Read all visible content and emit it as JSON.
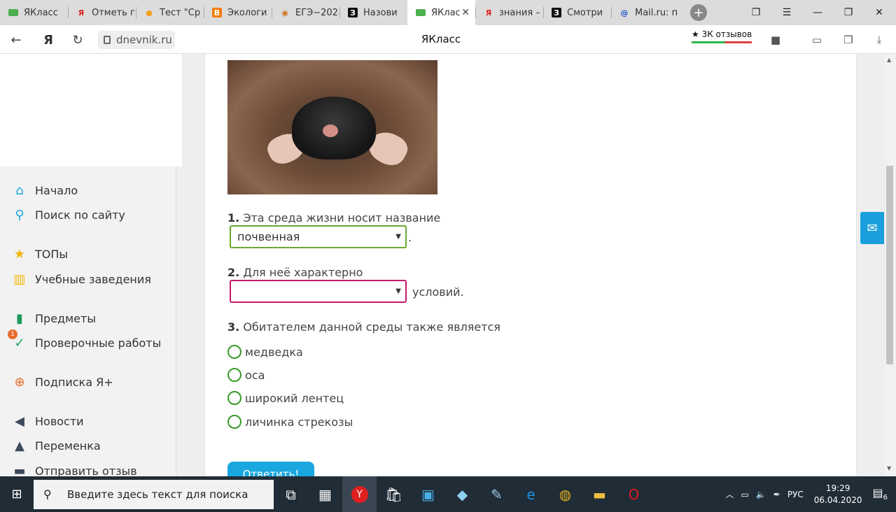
{
  "browser": {
    "tabs": [
      {
        "title": "ЯКласс",
        "icon": "yaklass-icon",
        "color": "#4caf50",
        "active": false
      },
      {
        "title": "Отметь г",
        "icon": "yandex-icon",
        "color": "#e02020",
        "active": false
      },
      {
        "title": "Тест \"Ср",
        "icon": "test-icon",
        "color": "#f0a020",
        "active": false
      },
      {
        "title": "Экологи",
        "icon": "blogger-icon",
        "color": "#f57c00",
        "active": false
      },
      {
        "title": "ЕГЭ−202",
        "icon": "ege-icon",
        "color": "#d0701c",
        "active": false
      },
      {
        "title": "Назови",
        "icon": "znanija-icon",
        "color": "#111111",
        "active": false
      },
      {
        "title": "ЯКлас",
        "icon": "yaklass-icon",
        "color": "#4caf50",
        "active": true
      },
      {
        "title": "знания –",
        "icon": "yandex-icon",
        "color": "#e02020",
        "active": false
      },
      {
        "title": "Смотри",
        "icon": "znanija-icon",
        "color": "#111111",
        "active": false
      },
      {
        "title": "Mail.ru: п",
        "icon": "mailru-icon",
        "color": "#1a4fc4",
        "active": false
      }
    ],
    "url": "dnevnik.ru",
    "page_title": "ЯКласс",
    "reviews": "★ 3К отзывов"
  },
  "sidebar": {
    "items": [
      {
        "label": "Начало",
        "icon": "home-icon",
        "glyph": "⌂",
        "color": "#1aa7e0"
      },
      {
        "label": "Поиск по сайту",
        "icon": "search-icon",
        "glyph": "⚲",
        "color": "#1aa7e0"
      },
      {
        "label": "ТОПы",
        "icon": "star-icon",
        "glyph": "★",
        "color": "#f5b400"
      },
      {
        "label": "Учебные заведения",
        "icon": "institution-icon",
        "glyph": "🏛",
        "color": "#f5b400"
      },
      {
        "label": "Предметы",
        "icon": "book-icon",
        "glyph": "▮",
        "color": "#1b9a5a"
      },
      {
        "label": "Проверочные работы",
        "icon": "check-icon",
        "glyph": "✓",
        "color": "#1b9a5a",
        "badge": "1"
      },
      {
        "label": "Подписка Я+",
        "icon": "subscription-icon",
        "glyph": "⊕",
        "color": "#e86c2d"
      },
      {
        "label": "Новости",
        "icon": "megaphone-icon",
        "glyph": "◀",
        "color": "#3c4a5a"
      },
      {
        "label": "Переменка",
        "icon": "bell-icon",
        "glyph": "🔔",
        "color": "#3c4a5a"
      },
      {
        "label": "Отправить отзыв",
        "icon": "feedback-icon",
        "glyph": "▬",
        "color": "#3c4a5a"
      }
    ]
  },
  "quiz": {
    "q1": {
      "num": "1.",
      "text": "Эта среда жизни носит название",
      "selected": "почвенная",
      "suffix": "."
    },
    "q2": {
      "num": "2.",
      "text": "Для неё характерно",
      "selected": "",
      "suffix": "условий."
    },
    "q3": {
      "num": "3.",
      "text": "Обитателем данной среды также является",
      "options": [
        "медведка",
        "оса",
        "широкий лентец",
        "личинка стрекозы"
      ]
    },
    "submit_label": "Ответить!"
  },
  "taskbar": {
    "search_placeholder": "Введите здесь текст для поиска",
    "lang": "РУС",
    "time": "19:29",
    "date": "06.04.2020",
    "notifications": "6"
  },
  "colors": {
    "select_ok": "#6aa82e",
    "select_empty": "#c2186b",
    "accent": "#1aa7e0"
  }
}
